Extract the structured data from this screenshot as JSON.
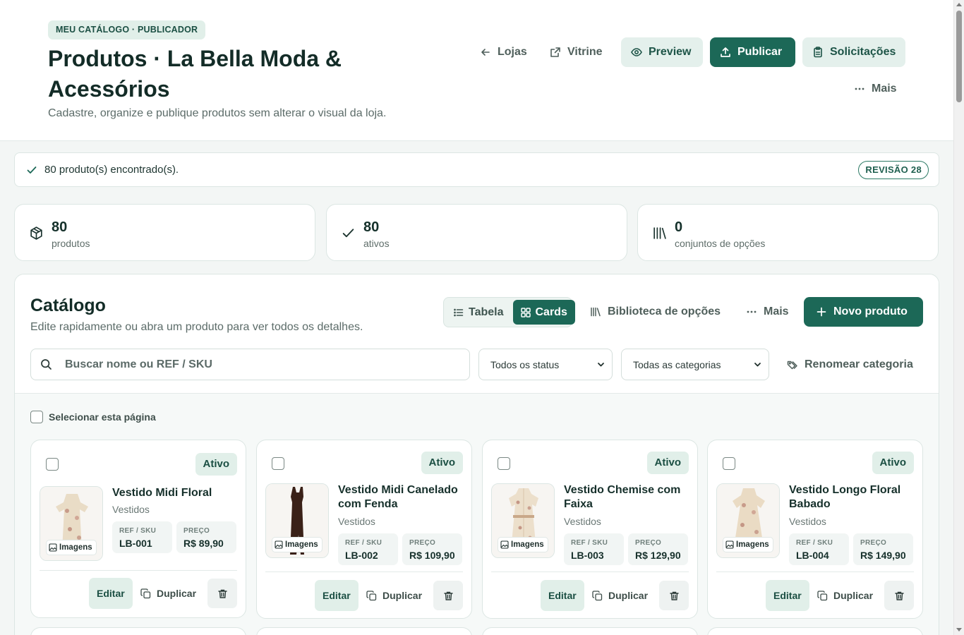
{
  "header": {
    "eyebrow": "MEU CATÁLOGO · PUBLICADOR",
    "title": "Produtos · La Bella Moda & Acessórios",
    "subtitle": "Cadastre, organize e publique produtos sem alterar o visual da loja.",
    "actions": {
      "lojas": "Lojas",
      "vitrine": "Vitrine",
      "preview": "Preview",
      "publicar": "Publicar",
      "solicitacoes": "Solicitações",
      "mais": "Mais"
    }
  },
  "status": {
    "text": "80 produto(s) encontrado(s).",
    "revision": "REVISÃO 28"
  },
  "stats": [
    {
      "value": "80",
      "label": "produtos",
      "icon": "box-icon"
    },
    {
      "value": "80",
      "label": "ativos",
      "icon": "check-icon"
    },
    {
      "value": "0",
      "label": "conjuntos de opções",
      "icon": "library-icon"
    }
  ],
  "catalog": {
    "title": "Catálogo",
    "subtitle": "Edite rapidamente ou abra um produto para ver todos os detalhes.",
    "view_table": "Tabela",
    "view_cards": "Cards",
    "active_view": "Cards",
    "options_library": "Biblioteca de opções",
    "more": "Mais",
    "new_product": "Novo produto",
    "search_placeholder": "Buscar nome ou REF / SKU",
    "status_filter": "Todos os status",
    "category_filter": "Todas as categorias",
    "rename_category": "Renomear categoria",
    "select_page": "Selecionar esta página"
  },
  "labels": {
    "ref_sku": "REF / SKU",
    "price": "PREÇO",
    "images": "Imagens",
    "edit": "Editar",
    "duplicate": "Duplicar"
  },
  "products": [
    {
      "name": "Vestido Midi Floral",
      "category": "Vestidos",
      "status": "Ativo",
      "sku": "LB-001",
      "price": "R$ 89,90"
    },
    {
      "name": "Vestido Midi Canelado com Fenda",
      "category": "Vestidos",
      "status": "Ativo",
      "sku": "LB-002",
      "price": "R$ 109,90"
    },
    {
      "name": "Vestido Chemise com Faixa",
      "category": "Vestidos",
      "status": "Ativo",
      "sku": "LB-003",
      "price": "R$ 129,90"
    },
    {
      "name": "Vestido Longo Floral Babado",
      "category": "Vestidos",
      "status": "Ativo",
      "sku": "LB-004",
      "price": "R$ 149,90"
    }
  ],
  "colors": {
    "brand": "#1c6857",
    "brand_soft": "#e1efe9",
    "text": "#16302b"
  }
}
